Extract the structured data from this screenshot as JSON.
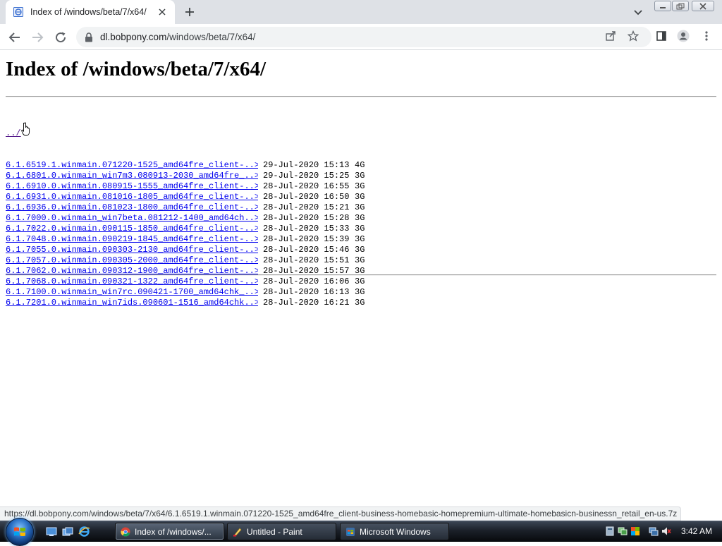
{
  "browser": {
    "tab": {
      "title": "Index of /windows/beta/7/x64/"
    },
    "url": {
      "host": "dl.bobpony.com",
      "path": "/windows/beta/7/x64/"
    }
  },
  "page": {
    "title": "Index of /windows/beta/7/x64/",
    "parent_link": "../",
    "entries": [
      {
        "name": "6.1.6519.1.winmain.071220-1525_amd64fre_client-..>",
        "date": "29-Jul-2020 15:13",
        "size": "4G"
      },
      {
        "name": "6.1.6801.0.winmain_win7m3.080913-2030_amd64fre_..>",
        "date": "29-Jul-2020 15:25",
        "size": "3G"
      },
      {
        "name": "6.1.6910.0.winmain.080915-1555_amd64fre_client-..>",
        "date": "28-Jul-2020 16:55",
        "size": "3G"
      },
      {
        "name": "6.1.6931.0.winmain.081016-1805_amd64fre_client-..>",
        "date": "28-Jul-2020 16:50",
        "size": "3G"
      },
      {
        "name": "6.1.6936.0.winmain.081023-1800_amd64fre_client-..>",
        "date": "28-Jul-2020 15:21",
        "size": "3G"
      },
      {
        "name": "6.1.7000.0.winmain_win7beta.081212-1400_amd64ch..>",
        "date": "28-Jul-2020 15:28",
        "size": "3G"
      },
      {
        "name": "6.1.7022.0.winmain.090115-1850_amd64fre_client-..>",
        "date": "28-Jul-2020 15:33",
        "size": "3G"
      },
      {
        "name": "6.1.7048.0.winmain.090219-1845_amd64fre_client-..>",
        "date": "28-Jul-2020 15:39",
        "size": "3G"
      },
      {
        "name": "6.1.7055.0.winmain.090303-2130_amd64fre_client-..>",
        "date": "28-Jul-2020 15:46",
        "size": "3G"
      },
      {
        "name": "6.1.7057.0.winmain.090305-2000_amd64fre_client-..>",
        "date": "28-Jul-2020 15:51",
        "size": "3G"
      },
      {
        "name": "6.1.7062.0.winmain.090312-1900_amd64fre_client-..>",
        "date": "28-Jul-2020 15:57",
        "size": "3G"
      },
      {
        "name": "6.1.7068.0.winmain.090321-1322_amd64fre_client-..>",
        "date": "28-Jul-2020 16:06",
        "size": "3G"
      },
      {
        "name": "6.1.7100.0.winmain_win7rc.090421-1700_amd64chk_..>",
        "date": "28-Jul-2020 16:13",
        "size": "3G"
      },
      {
        "name": "6.1.7201.0.winmain_win7ids.090601-1516_amd64chk..>",
        "date": "28-Jul-2020 16:21",
        "size": "3G"
      }
    ]
  },
  "status_bar": {
    "hover_url": "https://dl.bobpony.com/windows/beta/7/x64/6.1.6519.1.winmain.071220-1525_amd64fre_client-business-homebasic-homepremium-ultimate-homebasicn-businessn_retail_en-us.7z"
  },
  "taskbar": {
    "tasks": [
      {
        "label": "Index of /windows/...",
        "icon": "chrome-icon",
        "active": true
      },
      {
        "label": "Untitled - Paint",
        "icon": "paint-icon",
        "active": false
      },
      {
        "label": "Microsoft Windows",
        "icon": "windows-setup-icon",
        "active": false
      }
    ],
    "clock": "3:42 AM"
  },
  "colors": {
    "link": "#0000ee",
    "visited_link": "#551a8b",
    "tabstrip_bg": "#dee1e6",
    "omnibox_bg": "#f1f3f4"
  }
}
